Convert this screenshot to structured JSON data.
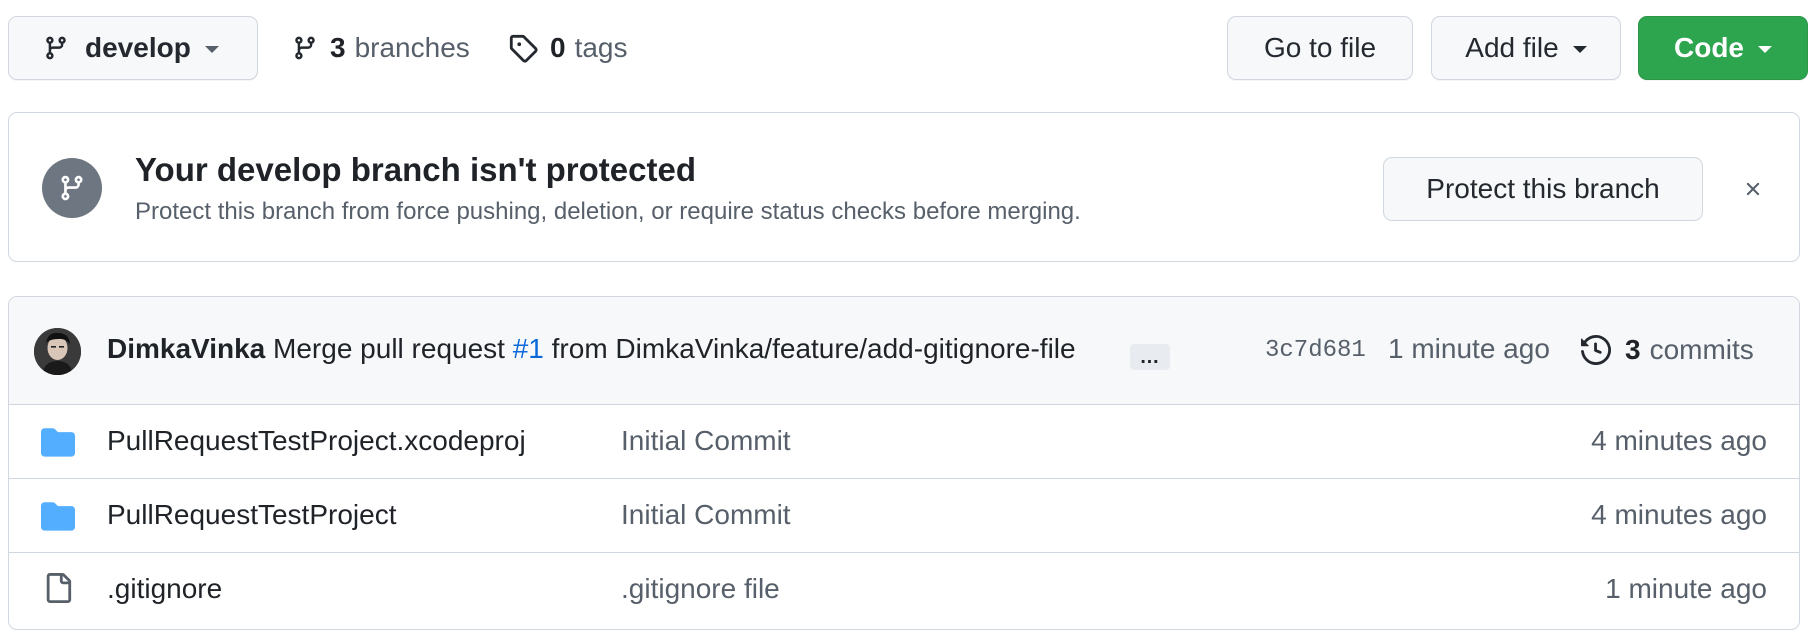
{
  "toolbar": {
    "branch_name": "develop",
    "branches_count": "3",
    "branches_label": "branches",
    "tags_count": "0",
    "tags_label": "tags",
    "goto_file_label": "Go to file",
    "add_file_label": "Add file",
    "code_label": "Code"
  },
  "banner": {
    "title": "Your develop branch isn't protected",
    "subtitle": "Protect this branch from force pushing, deletion, or require status checks before merging.",
    "protect_button_label": "Protect this branch"
  },
  "commit": {
    "author": "DimkaVinka",
    "message_prefix": "Merge pull request",
    "pr_number": "#1",
    "message_suffix": "from DimkaVinka/feature/add-gitignore-file",
    "ellipsis": "…",
    "sha": "3c7d681",
    "time": "1 minute ago",
    "commits_count": "3",
    "commits_label": "commits"
  },
  "files": [
    {
      "type": "folder",
      "name": "PullRequestTestProject.xcodeproj",
      "message": "Initial Commit",
      "time": "4 minutes ago"
    },
    {
      "type": "folder",
      "name": "PullRequestTestProject",
      "message": "Initial Commit",
      "time": "4 minutes ago"
    },
    {
      "type": "file",
      "name": ".gitignore",
      "message": ".gitignore file",
      "time": "1 minute ago"
    }
  ],
  "icons": {
    "branch": "git-branch-icon",
    "tag": "tag-icon",
    "history": "history-icon",
    "folder": "folder-icon",
    "file": "file-icon",
    "close": "close-icon"
  },
  "colors": {
    "code_button": "#2da44e",
    "link": "#0969da",
    "folder": "#54aeff",
    "muted_text": "#57606a",
    "border": "#d0d7de"
  }
}
